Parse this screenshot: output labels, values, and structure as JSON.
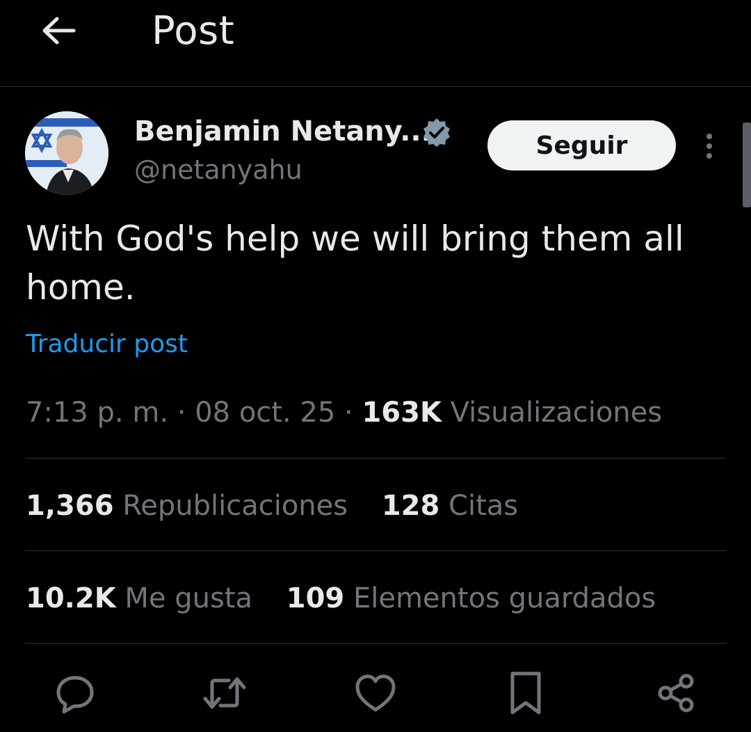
{
  "header": {
    "title": "Post",
    "back_icon": "arrow-left-icon"
  },
  "author": {
    "name": "Benjamin Netany...",
    "handle": "@netanyahu",
    "verified_color": "#829aab",
    "follow_label": "Seguir"
  },
  "post": {
    "text": "With God's help we will bring them all home.",
    "translate_label": "Traducir post",
    "time": "7:13 p. m.",
    "separator": "·",
    "date": "08 oct. 25",
    "views_count": "163K",
    "views_label": "Visualizaciones"
  },
  "stats": {
    "reposts_count": "1,366",
    "reposts_label": "Republicaciones",
    "quotes_count": "128",
    "quotes_label": "Citas",
    "likes_count": "10.2K",
    "likes_label": "Me gusta",
    "bookmarks_count": "109",
    "bookmarks_label": "Elementos guardados"
  },
  "actions": [
    "reply-icon",
    "repost-icon",
    "like-icon",
    "bookmark-icon",
    "share-icon"
  ],
  "colors": {
    "background": "#000000",
    "text": "#e7e9ea",
    "secondary_text": "#71767b",
    "link": "#1d9bf0",
    "divider": "#2f3336"
  }
}
